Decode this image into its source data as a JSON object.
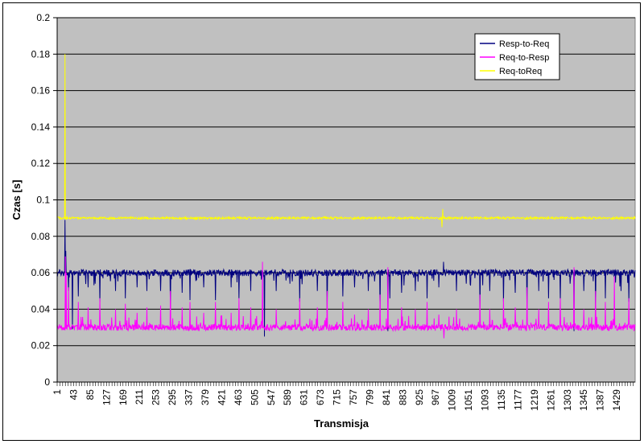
{
  "chart_data": {
    "type": "line",
    "xlabel": "Transmisja",
    "ylabel": "Czas [s]",
    "ylim": [
      0,
      0.2
    ],
    "y_ticks": [
      "0",
      "0.02",
      "0.04",
      "0.06",
      "0.08",
      "0.1",
      "0.12",
      "0.14",
      "0.16",
      "0.18",
      "0.2"
    ],
    "x_range": [
      1,
      1476
    ],
    "x_tick_labels": [
      "1",
      "43",
      "85",
      "127",
      "169",
      "211",
      "253",
      "295",
      "337",
      "379",
      "421",
      "463",
      "505",
      "547",
      "589",
      "631",
      "673",
      "715",
      "757",
      "799",
      "841",
      "883",
      "925",
      "967",
      "1009",
      "1051",
      "1093",
      "1135",
      "1177",
      "1219",
      "1261",
      "1303",
      "1345",
      "1387",
      "1429"
    ],
    "grid": true,
    "legend_position": "top-right",
    "plot_background": "#c0c0c0",
    "series": [
      {
        "name": "Resp-to-Req",
        "color": "#000080",
        "baseline": 0.06,
        "spikes": [
          [
            21,
            0.089
          ],
          [
            23,
            0.072
          ],
          [
            40,
            0.029
          ],
          [
            530,
            0.025
          ],
          [
            845,
            0.028
          ],
          [
            987,
            0.066
          ],
          [
            1320,
            0.028
          ]
        ],
        "dips": [
          [
            30,
            0.05
          ],
          [
            55,
            0.047
          ],
          [
            80,
            0.052
          ],
          [
            98,
            0.054
          ],
          [
            110,
            0.044
          ],
          [
            150,
            0.05
          ],
          [
            175,
            0.046
          ],
          [
            205,
            0.052
          ],
          [
            230,
            0.05
          ],
          [
            265,
            0.05
          ],
          [
            290,
            0.04
          ],
          [
            320,
            0.049
          ],
          [
            340,
            0.045
          ],
          [
            375,
            0.052
          ],
          [
            405,
            0.045
          ],
          [
            445,
            0.052
          ],
          [
            465,
            0.046
          ],
          [
            495,
            0.05
          ],
          [
            560,
            0.05
          ],
          [
            595,
            0.054
          ],
          [
            620,
            0.044
          ],
          [
            665,
            0.05
          ],
          [
            690,
            0.038
          ],
          [
            730,
            0.047
          ],
          [
            760,
            0.052
          ],
          [
            795,
            0.05
          ],
          [
            825,
            0.038
          ],
          [
            850,
            0.046
          ],
          [
            880,
            0.049
          ],
          [
            915,
            0.05
          ],
          [
            945,
            0.046
          ],
          [
            975,
            0.052
          ],
          [
            1020,
            0.05
          ],
          [
            1045,
            0.054
          ],
          [
            1080,
            0.041
          ],
          [
            1105,
            0.05
          ],
          [
            1140,
            0.044
          ],
          [
            1170,
            0.049
          ],
          [
            1200,
            0.036
          ],
          [
            1230,
            0.05
          ],
          [
            1255,
            0.046
          ],
          [
            1285,
            0.045
          ],
          [
            1310,
            0.054
          ],
          [
            1345,
            0.05
          ],
          [
            1375,
            0.038
          ],
          [
            1400,
            0.046
          ],
          [
            1440,
            0.05
          ],
          [
            1460,
            0.044
          ]
        ]
      },
      {
        "name": "Req-to-Resp",
        "color": "#ff00ff",
        "baseline": 0.03,
        "spikes": [
          [
            22,
            0.069
          ],
          [
            24,
            0.06
          ],
          [
            30,
            0.052
          ],
          [
            55,
            0.044
          ],
          [
            80,
            0.041
          ],
          [
            110,
            0.046
          ],
          [
            150,
            0.04
          ],
          [
            175,
            0.043
          ],
          [
            205,
            0.038
          ],
          [
            230,
            0.041
          ],
          [
            265,
            0.042
          ],
          [
            290,
            0.05
          ],
          [
            320,
            0.041
          ],
          [
            340,
            0.044
          ],
          [
            375,
            0.038
          ],
          [
            405,
            0.044
          ],
          [
            445,
            0.038
          ],
          [
            465,
            0.046
          ],
          [
            495,
            0.041
          ],
          [
            525,
            0.066
          ],
          [
            560,
            0.04
          ],
          [
            620,
            0.046
          ],
          [
            665,
            0.041
          ],
          [
            690,
            0.05
          ],
          [
            730,
            0.044
          ],
          [
            760,
            0.037
          ],
          [
            795,
            0.04
          ],
          [
            825,
            0.048
          ],
          [
            845,
            0.063
          ],
          [
            880,
            0.041
          ],
          [
            915,
            0.04
          ],
          [
            945,
            0.044
          ],
          [
            975,
            0.037
          ],
          [
            1020,
            0.04
          ],
          [
            1080,
            0.048
          ],
          [
            1105,
            0.04
          ],
          [
            1140,
            0.046
          ],
          [
            1170,
            0.041
          ],
          [
            1200,
            0.052
          ],
          [
            1230,
            0.04
          ],
          [
            1255,
            0.044
          ],
          [
            1285,
            0.046
          ],
          [
            1320,
            0.063
          ],
          [
            1345,
            0.04
          ],
          [
            1375,
            0.05
          ],
          [
            1400,
            0.044
          ],
          [
            1423,
            0.058
          ],
          [
            1460,
            0.046
          ]
        ],
        "dips": [
          [
            988,
            0.024
          ]
        ]
      },
      {
        "name": "Req-toReq",
        "color": "#ffff00",
        "baseline": 0.09,
        "spikes": [
          [
            21,
            0.18
          ],
          [
            328,
            0.091
          ],
          [
            683,
            0.091
          ],
          [
            985,
            0.095
          ]
        ],
        "dips": [
          [
            983,
            0.085
          ]
        ]
      }
    ]
  }
}
